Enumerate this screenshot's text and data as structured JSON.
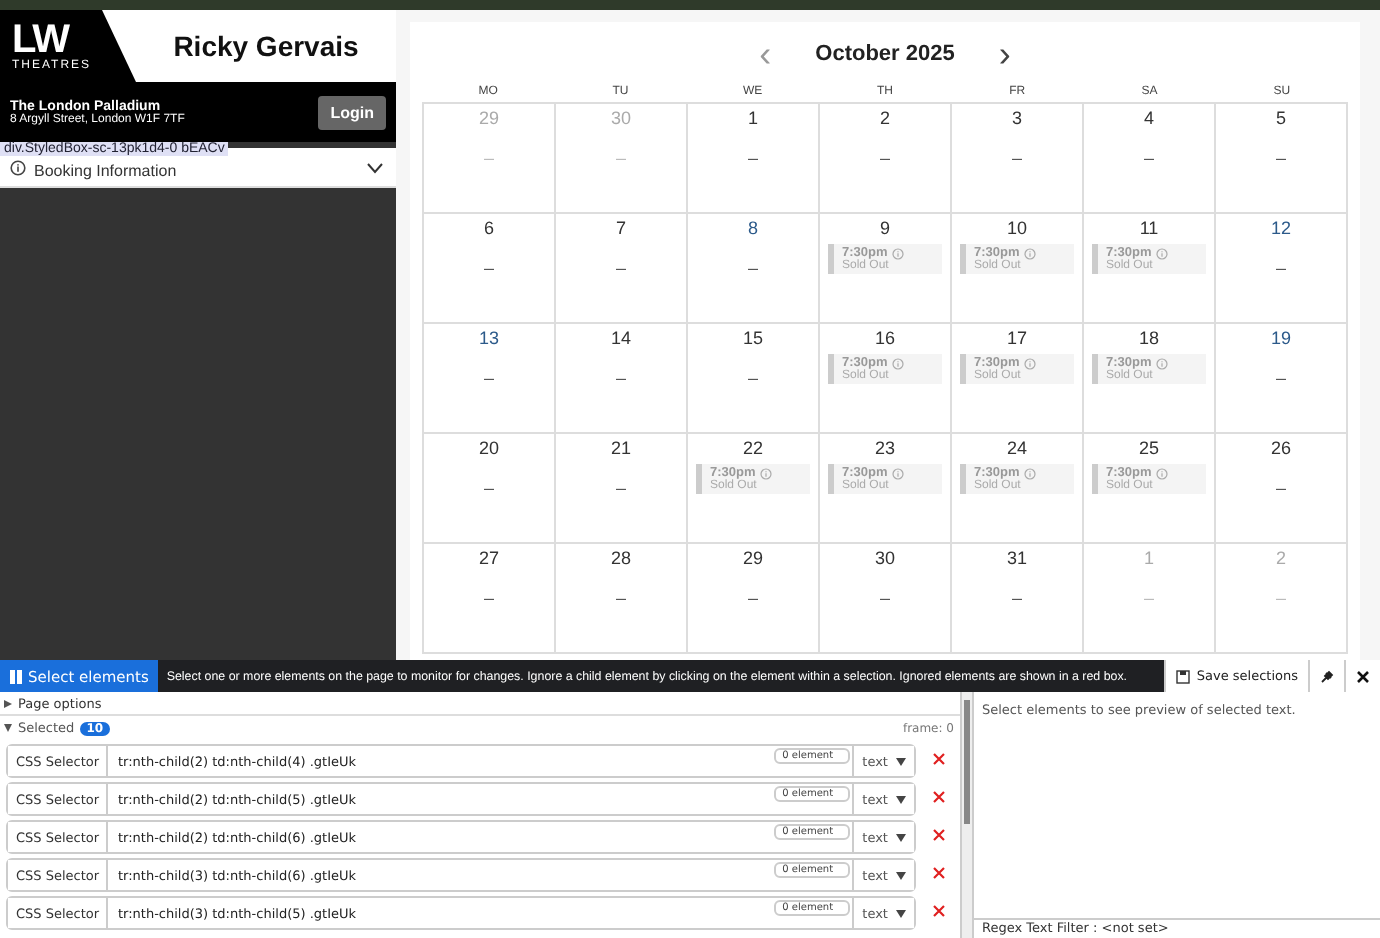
{
  "sidebar": {
    "logo": {
      "letters": "LW",
      "caption": "THEATRES"
    },
    "artist": "Ricky Gervais",
    "venue": {
      "name": "The London Palladium",
      "address": "8 Argyll Street, London W1F 7TF"
    },
    "login_button": "Login",
    "inspector_tooltip": "div.StyledBox-sc-13pk1d4-0 bEACv",
    "booking_info": {
      "label": "Booking Information",
      "expanded": false
    }
  },
  "calendar": {
    "title": "October 2025",
    "prev": "‹",
    "next": "›",
    "weekdays": [
      "MO",
      "TU",
      "WE",
      "TH",
      "FR",
      "SA",
      "SU"
    ],
    "days": [
      {
        "day": "29",
        "muted": true,
        "highlighted": false
      },
      {
        "day": "30",
        "muted": true,
        "highlighted": false
      },
      {
        "day": "1",
        "muted": false,
        "highlighted": false
      },
      {
        "day": "2",
        "muted": false,
        "highlighted": false
      },
      {
        "day": "3",
        "muted": false,
        "highlighted": false
      },
      {
        "day": "4",
        "muted": false,
        "highlighted": false
      },
      {
        "day": "5",
        "muted": false,
        "highlighted": false
      },
      {
        "day": "6",
        "muted": false,
        "highlighted": false
      },
      {
        "day": "7",
        "muted": false,
        "highlighted": false
      },
      {
        "day": "8",
        "muted": false,
        "highlighted": true
      },
      {
        "day": "9",
        "muted": false,
        "highlighted": false,
        "events": [
          {
            "time": "7:30pm",
            "status": "Sold Out"
          }
        ]
      },
      {
        "day": "10",
        "muted": false,
        "highlighted": false,
        "events": [
          {
            "time": "7:30pm",
            "status": "Sold Out"
          }
        ]
      },
      {
        "day": "11",
        "muted": false,
        "highlighted": false,
        "events": [
          {
            "time": "7:30pm",
            "status": "Sold Out"
          }
        ]
      },
      {
        "day": "12",
        "muted": false,
        "highlighted": true
      },
      {
        "day": "13",
        "muted": false,
        "highlighted": true
      },
      {
        "day": "14",
        "muted": false,
        "highlighted": false
      },
      {
        "day": "15",
        "muted": false,
        "highlighted": false
      },
      {
        "day": "16",
        "muted": false,
        "highlighted": false,
        "events": [
          {
            "time": "7:30pm",
            "status": "Sold Out"
          }
        ]
      },
      {
        "day": "17",
        "muted": false,
        "highlighted": false,
        "events": [
          {
            "time": "7:30pm",
            "status": "Sold Out"
          }
        ]
      },
      {
        "day": "18",
        "muted": false,
        "highlighted": false,
        "events": [
          {
            "time": "7:30pm",
            "status": "Sold Out"
          }
        ]
      },
      {
        "day": "19",
        "muted": false,
        "highlighted": true
      },
      {
        "day": "20",
        "muted": false,
        "highlighted": false
      },
      {
        "day": "21",
        "muted": false,
        "highlighted": false
      },
      {
        "day": "22",
        "muted": false,
        "highlighted": false,
        "events": [
          {
            "time": "7:30pm",
            "status": "Sold Out"
          }
        ]
      },
      {
        "day": "23",
        "muted": false,
        "highlighted": false,
        "events": [
          {
            "time": "7:30pm",
            "status": "Sold Out"
          }
        ]
      },
      {
        "day": "24",
        "muted": false,
        "highlighted": false,
        "events": [
          {
            "time": "7:30pm",
            "status": "Sold Out"
          }
        ]
      },
      {
        "day": "25",
        "muted": false,
        "highlighted": false,
        "events": [
          {
            "time": "7:30pm",
            "status": "Sold Out"
          }
        ]
      },
      {
        "day": "26",
        "muted": false,
        "highlighted": false
      },
      {
        "day": "27",
        "muted": false,
        "highlighted": false
      },
      {
        "day": "28",
        "muted": false,
        "highlighted": false
      },
      {
        "day": "29",
        "muted": false,
        "highlighted": false
      },
      {
        "day": "30",
        "muted": false,
        "highlighted": false
      },
      {
        "day": "31",
        "muted": false,
        "highlighted": false
      },
      {
        "day": "1",
        "muted": true,
        "highlighted": false
      },
      {
        "day": "2",
        "muted": true,
        "highlighted": false
      }
    ],
    "empty_mark": "–"
  },
  "monitor_panel": {
    "select_button": "Select elements",
    "instructions": "Select one or more elements on the page to monitor for changes. Ignore a child element by clicking on the element within a selection. Ignored elements are shown in a red box.",
    "save_button": "Save selections",
    "page_options": {
      "label": "Page options",
      "expanded": false
    },
    "selected": {
      "label": "Selected",
      "count": "10",
      "expanded": true
    },
    "frame": "frame: 0",
    "selectors": [
      {
        "type": "CSS Selector",
        "value": "tr:nth-child(2) td:nth-child(4) .gtIeUk",
        "count": "0 element",
        "mode": "text"
      },
      {
        "type": "CSS Selector",
        "value": "tr:nth-child(2) td:nth-child(5) .gtIeUk",
        "count": "0 element",
        "mode": "text"
      },
      {
        "type": "CSS Selector",
        "value": "tr:nth-child(2) td:nth-child(6) .gtIeUk",
        "count": "0 element",
        "mode": "text"
      },
      {
        "type": "CSS Selector",
        "value": "tr:nth-child(3) td:nth-child(6) .gtIeUk",
        "count": "0 element",
        "mode": "text"
      },
      {
        "type": "CSS Selector",
        "value": "tr:nth-child(3) td:nth-child(5) .gtIeUk",
        "count": "0 element",
        "mode": "text"
      }
    ],
    "preview_text": "Select elements to see preview of selected text.",
    "regex_filter": "Regex Text Filter : <not set>"
  }
}
